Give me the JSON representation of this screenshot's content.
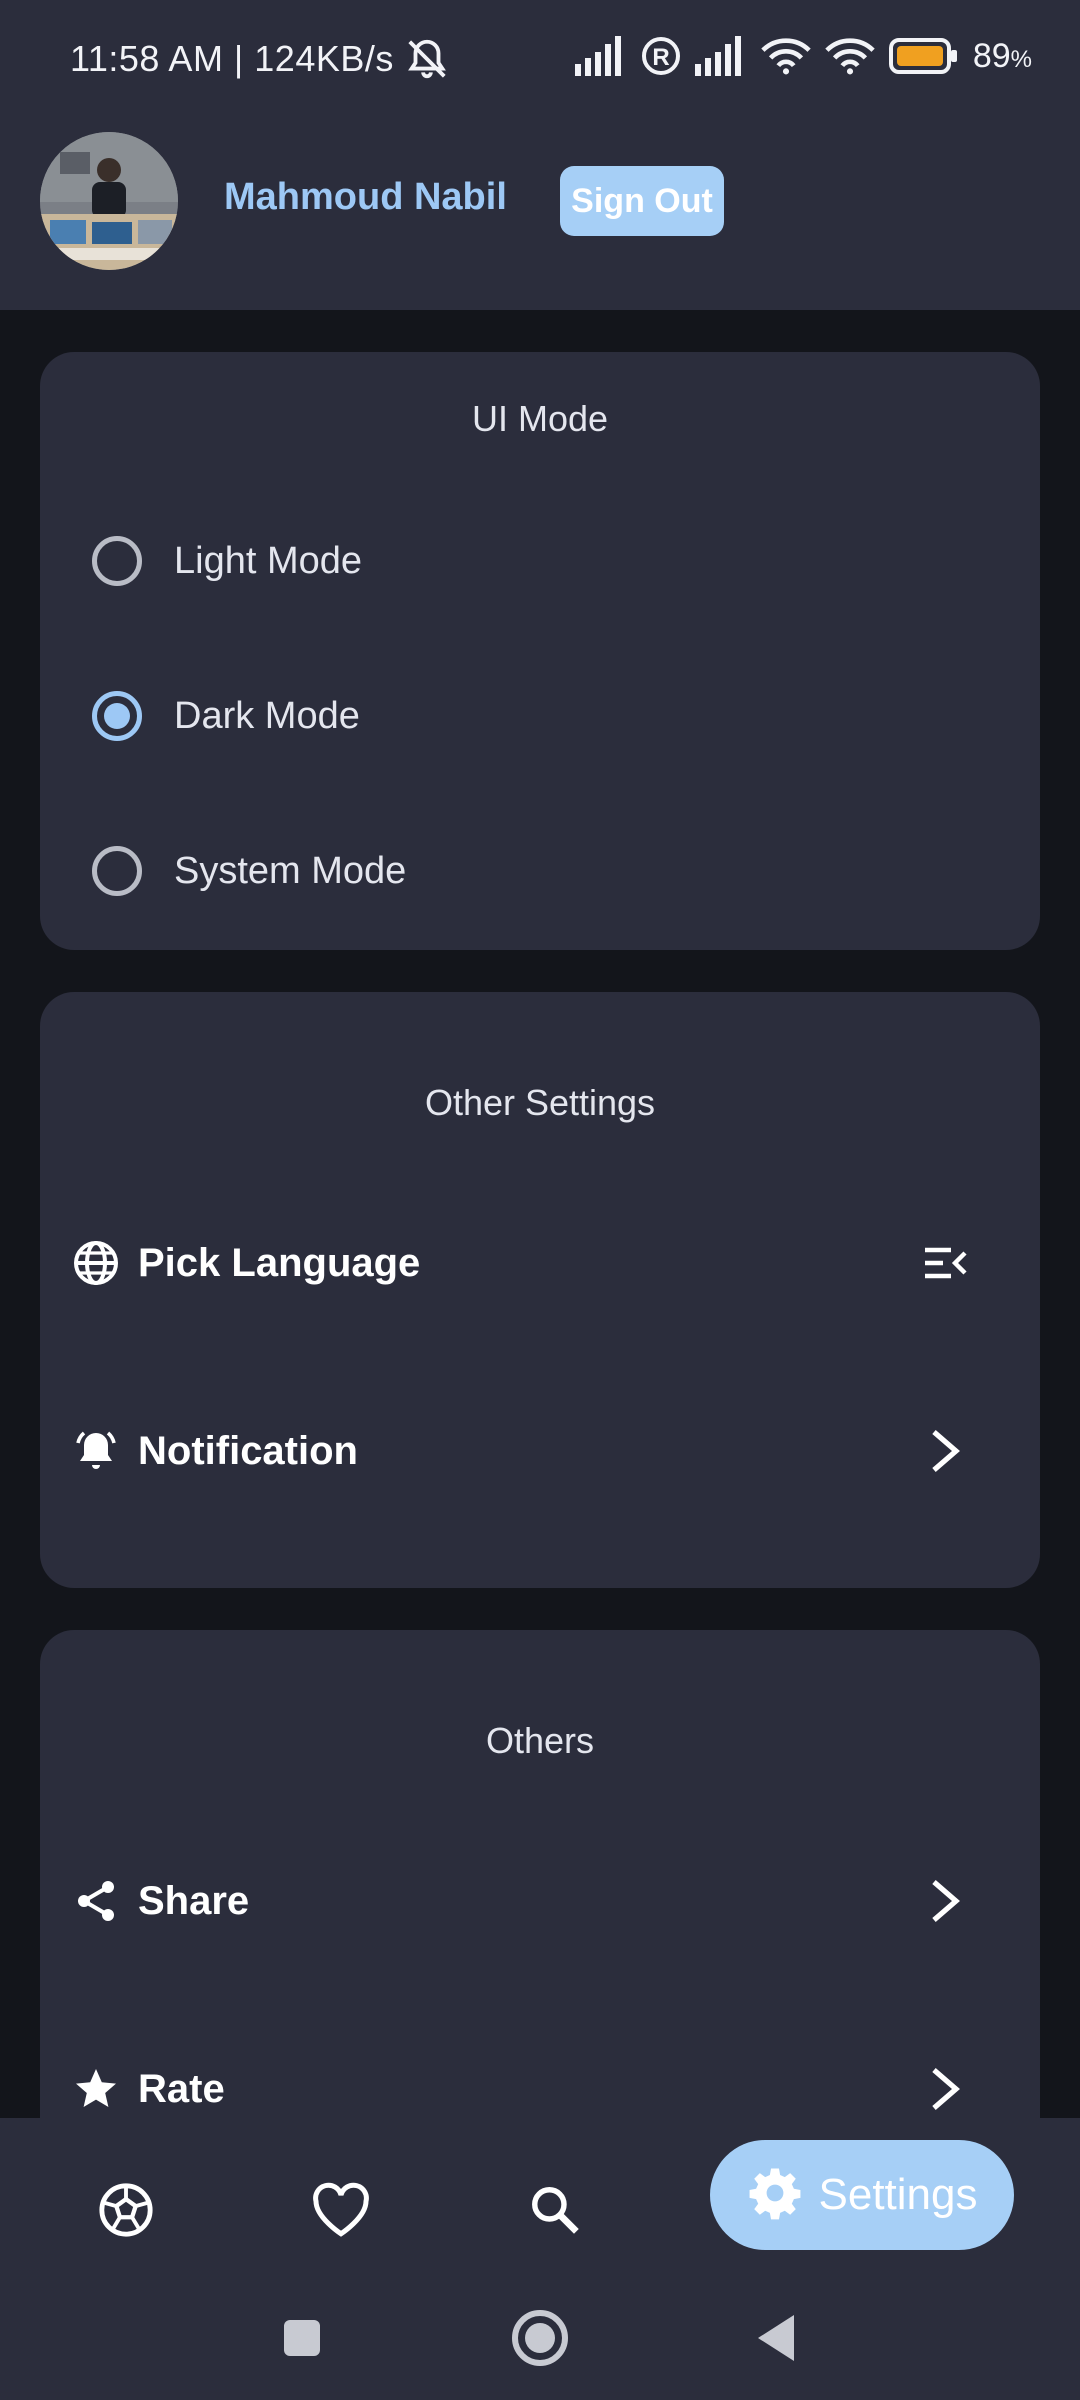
{
  "status_bar": {
    "time_speed": "11:58 AM | 124KB/s",
    "battery_percent": "89",
    "battery_unit": "%"
  },
  "profile": {
    "user_name": "Mahmoud Nabil",
    "sign_out_label": "Sign Out"
  },
  "ui_mode": {
    "title": "UI Mode",
    "options": [
      {
        "label": "Light Mode",
        "selected": false
      },
      {
        "label": "Dark Mode",
        "selected": true
      },
      {
        "label": "System Mode",
        "selected": false
      }
    ]
  },
  "other_settings": {
    "title": "Other Settings",
    "items": [
      {
        "label": "Pick Language",
        "icon": "globe-icon",
        "trailing_icon": "menu-collapse-icon"
      },
      {
        "label": "Notification",
        "icon": "bell-icon",
        "trailing_icon": "chevron-right-icon"
      }
    ]
  },
  "others": {
    "title": "Others",
    "items": [
      {
        "label": "Share",
        "icon": "share-icon",
        "trailing_icon": "chevron-right-icon"
      },
      {
        "label": "Rate",
        "icon": "star-icon",
        "trailing_icon": "chevron-right-icon"
      }
    ]
  },
  "bottom_nav": {
    "items": [
      {
        "icon": "soccer-ball-icon"
      },
      {
        "icon": "heart-icon"
      },
      {
        "icon": "search-icon"
      },
      {
        "icon": "gear-icon",
        "label": "Settings",
        "active": true
      }
    ]
  },
  "colors": {
    "accent": "#9dc8f5",
    "accent_fill": "#a6cff6",
    "surface": "#2b2d3c",
    "background": "#13151b",
    "battery": "#f0a020"
  }
}
